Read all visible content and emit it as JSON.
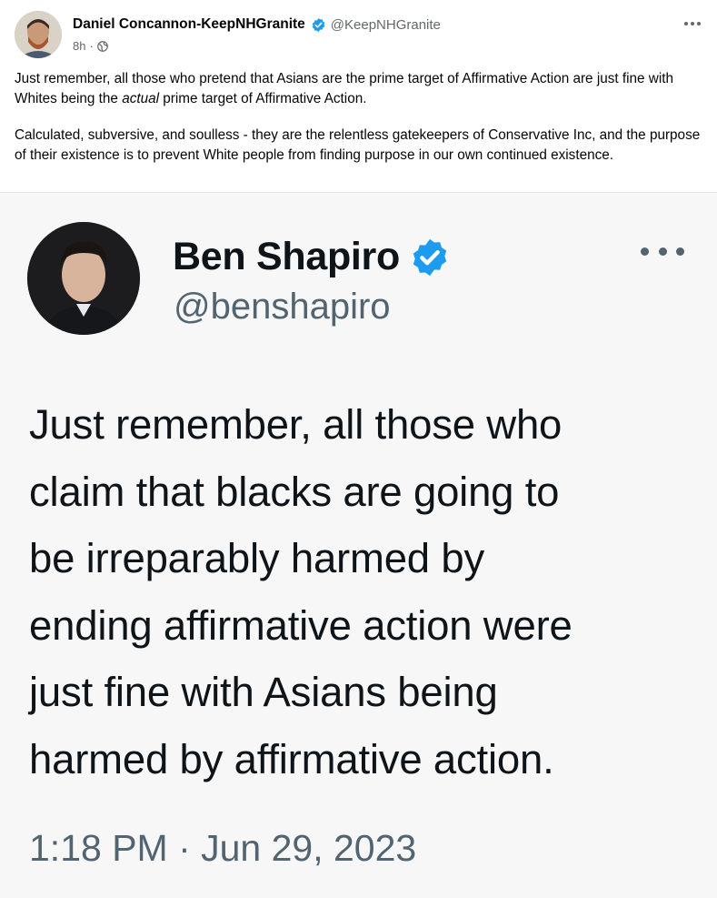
{
  "post": {
    "author_name": "Daniel Concannon-KeepNHGranite",
    "author_handle": "@KeepNHGranite",
    "time_ago": "8h",
    "meta_separator": "·",
    "paragraphs": [
      {
        "before": "Just remember, all those who pretend that Asians are the prime target of Affirmative Action are just fine with Whites being the ",
        "emphasis": "actual",
        "after": " prime target of Affirmative Action."
      },
      {
        "before": "Calculated, subversive, and soulless - they are the relentless gatekeepers of Conservative Inc, and the purpose of their existence is to prevent White people from finding purpose in our own continued existence.",
        "emphasis": "",
        "after": ""
      }
    ]
  },
  "embedded_tweet": {
    "name": "Ben Shapiro",
    "handle": "@benshapiro",
    "text_lines": [
      "Just remember, all those who",
      "claim that blacks are going to",
      "be irreparably harmed by",
      "ending affirmative action were",
      "just fine with Asians being",
      "harmed by affirmative action."
    ],
    "timestamp": "1:18 PM · Jun 29, 2023"
  },
  "icons": {
    "verified": "verified-badge-icon",
    "globe": "globe-icon",
    "more": "more-options-icon"
  },
  "colors": {
    "verified_blue": "#1d9bf0",
    "secondary_text": "#65676b",
    "tweet_secondary": "#536471",
    "embed_background": "#f7f7f7"
  }
}
